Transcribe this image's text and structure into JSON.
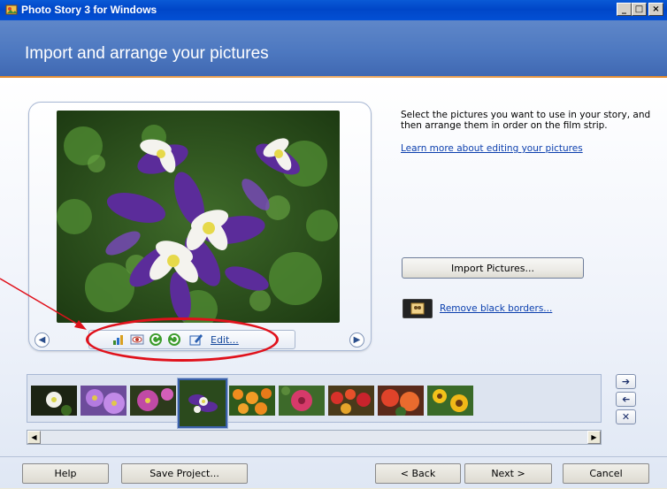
{
  "window": {
    "title": "Photo Story 3 for Windows",
    "controls": [
      "minimize",
      "maximize",
      "close"
    ]
  },
  "header": {
    "title": "Import and arrange your pictures"
  },
  "instructions": {
    "text": "Select the pictures you want to use in your story, and then arrange them in order on the film strip.",
    "learn_more": "Learn more about editing your pictures"
  },
  "actions": {
    "import_label": "Import Pictures...",
    "remove_borders_label": "Remove black borders..."
  },
  "preview_toolbar": {
    "icons": [
      "auto-correct-icon",
      "red-eye-icon",
      "rotate-left-icon",
      "rotate-right-icon",
      "edit-icon"
    ],
    "edit_label": "Edit..."
  },
  "filmstrip": {
    "thumbnails": [
      "white flower",
      "purple daisy",
      "pink flower",
      "purple columbine",
      "orange marigolds",
      "pink dahlia",
      "red flowers",
      "red orange flowers",
      "sunflowers"
    ],
    "selected_index": 3
  },
  "bottom_bar": {
    "help": "Help",
    "save_project": "Save Project...",
    "back": "< Back",
    "next": "Next >",
    "cancel": "Cancel"
  },
  "colors": {
    "header_blue": "#4d78c0",
    "titlebar_blue": "#0a5ad6",
    "accent_orange": "#e38a2d",
    "link_blue": "#0b3fae",
    "annotation_red": "#e0111b"
  }
}
